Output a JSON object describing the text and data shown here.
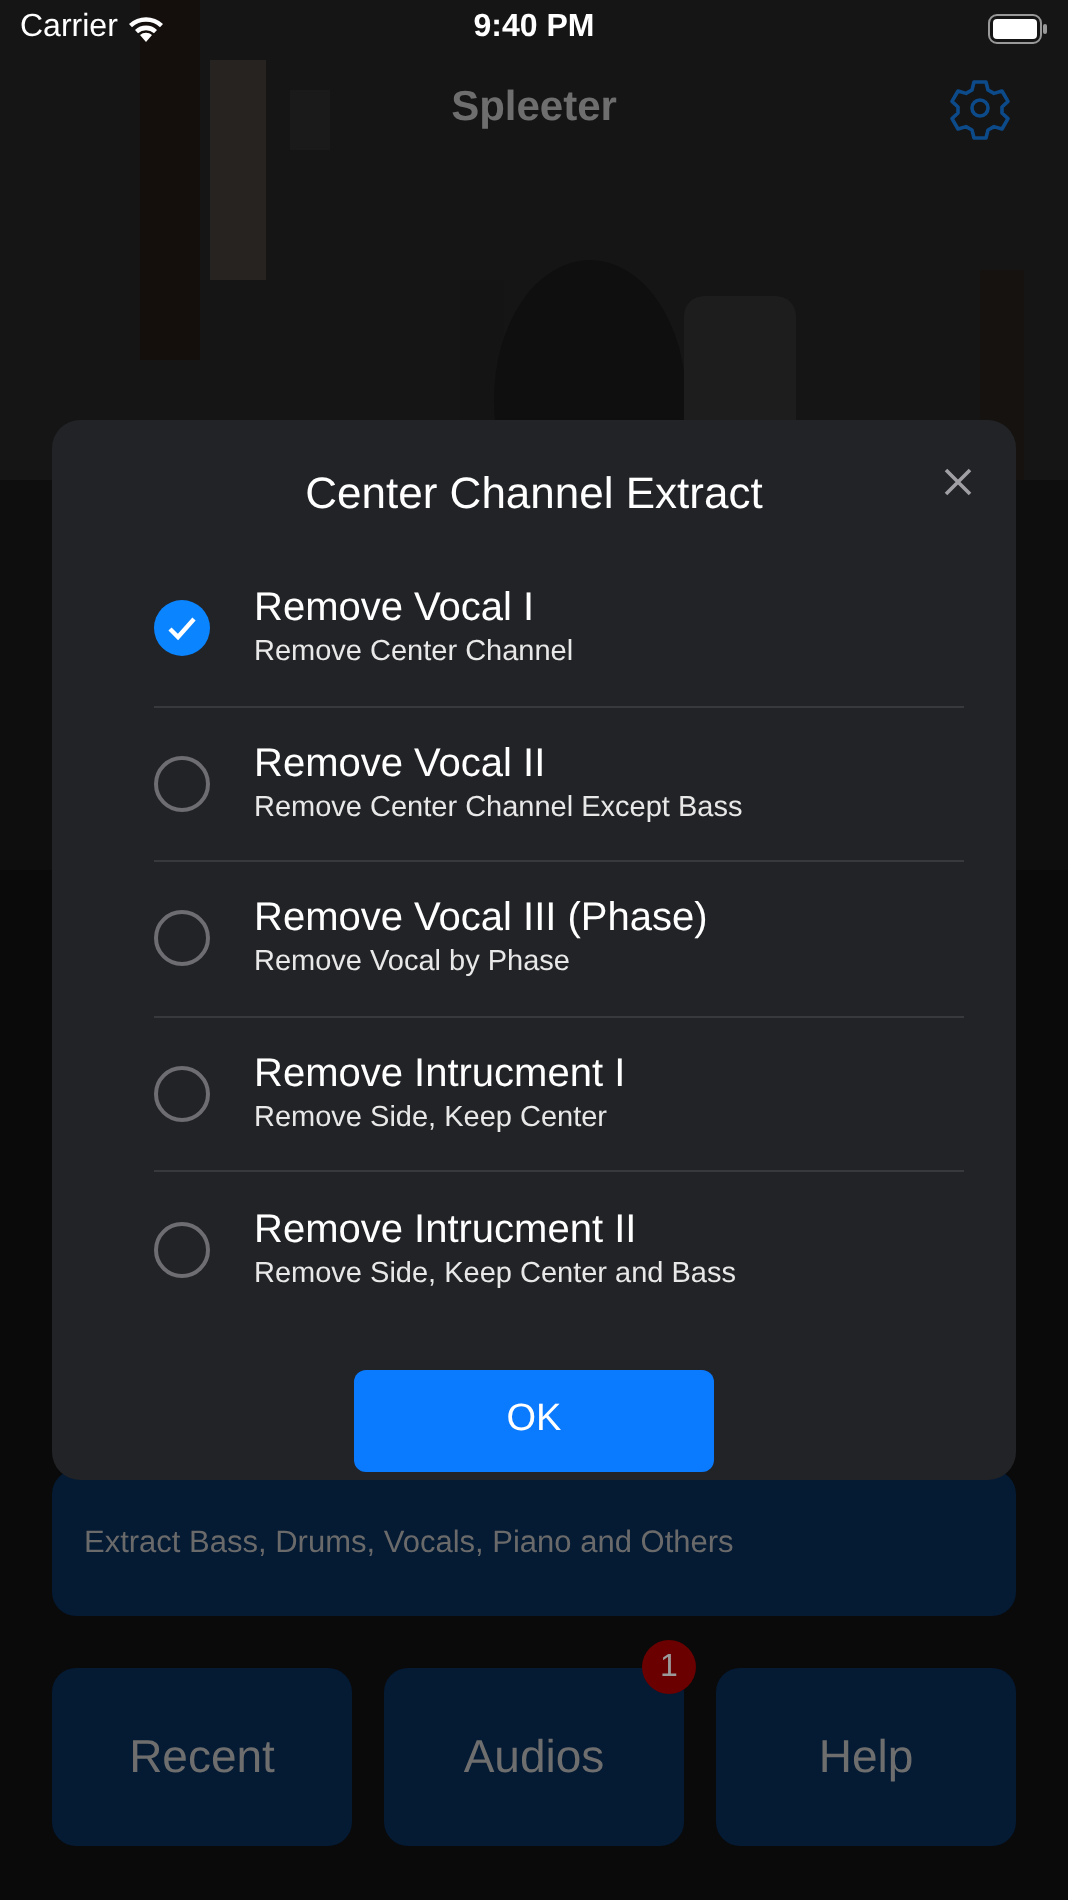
{
  "status_bar": {
    "carrier": "Carrier",
    "time": "9:40 PM"
  },
  "nav": {
    "title": "Spleeter"
  },
  "card": {
    "description": "Extract Bass, Drums, Vocals, Piano and Others"
  },
  "buttons": [
    {
      "label": "Recent"
    },
    {
      "label": "Audios",
      "badge": "1"
    },
    {
      "label": "Help"
    }
  ],
  "dialog": {
    "title": "Center Channel Extract",
    "options": [
      {
        "title": "Remove Vocal I",
        "subtitle": "Remove Center Channel",
        "selected": true
      },
      {
        "title": "Remove Vocal II",
        "subtitle": "Remove Center Channel Except Bass",
        "selected": false
      },
      {
        "title": "Remove Vocal III (Phase)",
        "subtitle": "Remove Vocal by Phase",
        "selected": false
      },
      {
        "title": "Remove Intrucment I",
        "subtitle": "Remove Side, Keep Center",
        "selected": false
      },
      {
        "title": "Remove Intrucment II",
        "subtitle": "Remove Side, Keep Center and Bass",
        "selected": false
      }
    ],
    "confirm": "OK"
  }
}
